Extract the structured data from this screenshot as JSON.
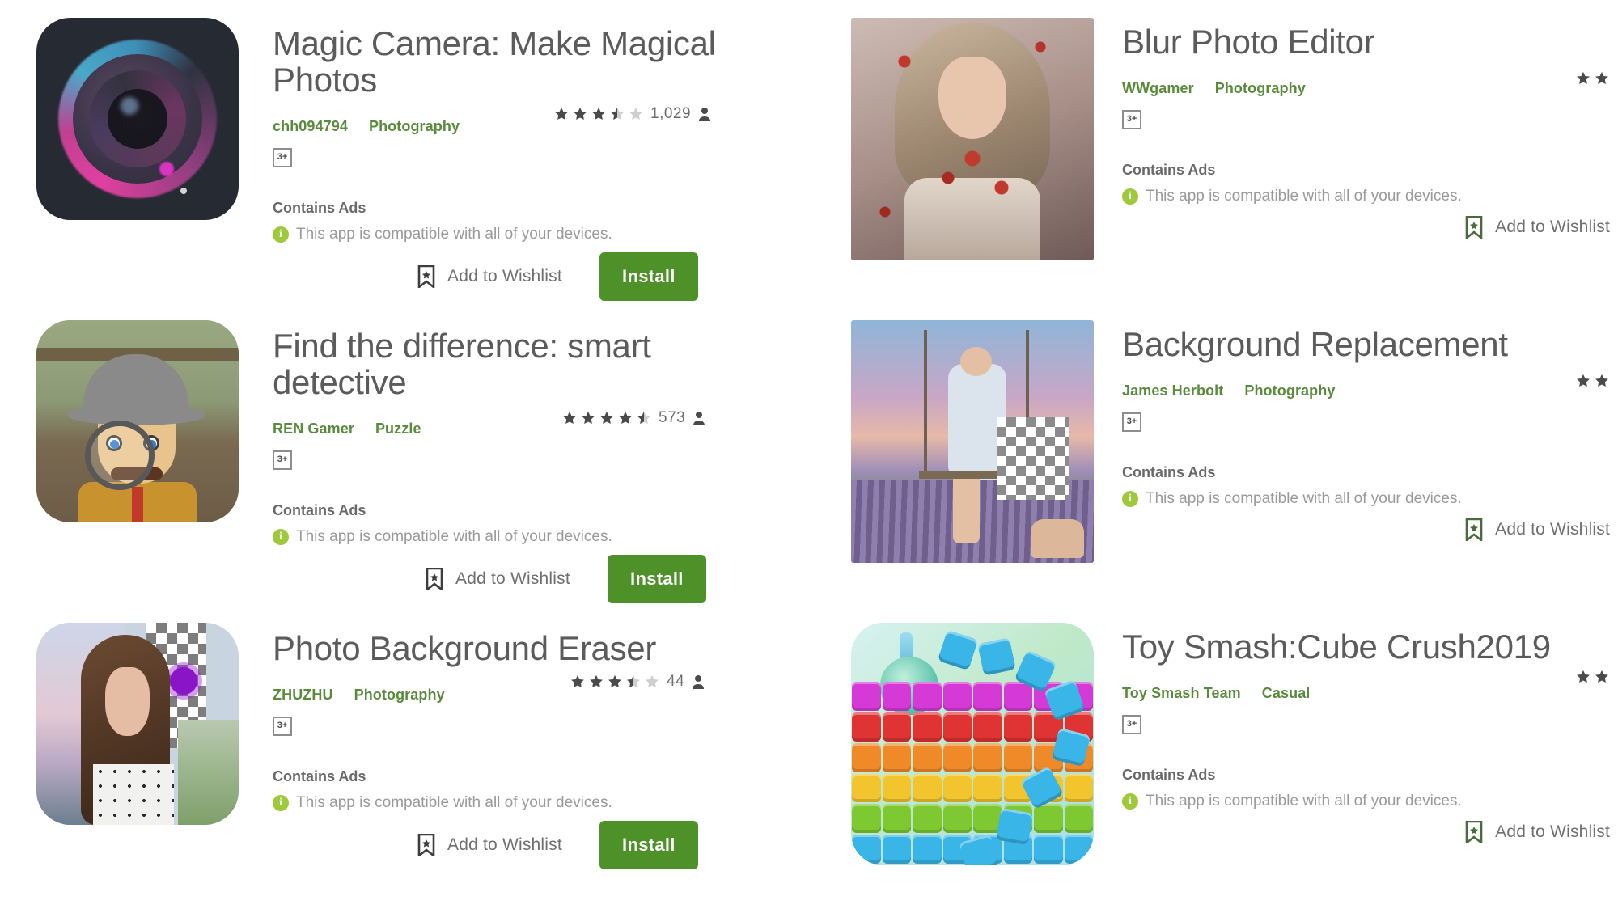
{
  "brand": {
    "install_green": "#4d9128",
    "link_green": "#5a8a3c",
    "info_green": "#9ec93a",
    "title_gray": "#5b5b5b",
    "muted_gray": "#9a9a9a"
  },
  "labels": {
    "contains_ads": "Contains Ads",
    "compatible": "This app is compatible with all of your devices.",
    "wishlist": "Add to Wishlist",
    "install": "Install",
    "age_rating": "3+"
  },
  "icons": {
    "star_full": "star-full-icon",
    "star_half": "star-half-icon",
    "star_empty": "star-empty-icon",
    "person": "person-icon",
    "bookmark": "bookmark-icon",
    "info": "info-icon",
    "age_badge": "age-rating-badge"
  },
  "left_column": [
    {
      "title": "Magic Camera: Make Magical Photos",
      "developer": "chh094794",
      "category": "Photography",
      "rating_full": 3,
      "rating_half": true,
      "rating_empty": 1,
      "rating_count": "1,029",
      "age_rating": "3+",
      "contains_ads": "Contains Ads",
      "compatible": "This app is compatible with all of your devices.",
      "wishlist": "Add to Wishlist",
      "install": "Install",
      "icon": "magic-camera-lens-icon"
    },
    {
      "title": "Find the difference: smart detective",
      "developer": "REN Gamer",
      "category": "Puzzle",
      "rating_full": 4,
      "rating_half": true,
      "rating_empty": 0,
      "rating_count": "573",
      "age_rating": "3+",
      "contains_ads": "Contains Ads",
      "compatible": "This app is compatible with all of your devices.",
      "wishlist": "Add to Wishlist",
      "install": "Install",
      "icon": "detective-character-icon"
    },
    {
      "title": "Photo Background Eraser",
      "developer": "ZHUZHU",
      "category": "Photography",
      "rating_full": 3,
      "rating_half": true,
      "rating_empty": 1,
      "rating_count": "44",
      "age_rating": "3+",
      "contains_ads": "Contains Ads",
      "compatible": "This app is compatible with all of your devices.",
      "wishlist": "Add to Wishlist",
      "install": "Install",
      "icon": "photo-eraser-portrait-icon"
    }
  ],
  "right_column": [
    {
      "title": "Blur Photo Editor",
      "developer": "WWgamer",
      "category": "Photography",
      "rating_visible_stars": 2,
      "age_rating": "3+",
      "contains_ads": "Contains Ads",
      "compatible": "This app is compatible with all of your devices.",
      "wishlist": "Add to Wishlist",
      "icon": "blur-photo-model-thumb"
    },
    {
      "title": "Background Replacement",
      "developer": "James Herbolt",
      "category": "Photography",
      "rating_visible_stars": 2,
      "age_rating": "3+",
      "contains_ads": "Contains Ads",
      "compatible": "This app is compatible with all of your devices.",
      "wishlist": "Add to Wishlist",
      "icon": "background-replacement-swing-thumb"
    },
    {
      "title": "Toy Smash:Cube Crush2019",
      "developer": "Toy Smash Team",
      "category": "Casual",
      "rating_visible_stars": 2,
      "age_rating": "3+",
      "contains_ads": "Contains Ads",
      "compatible": "This app is compatible with all of your devices.",
      "wishlist": "Add to Wishlist",
      "icon": "toy-smash-cubes-thumb"
    }
  ]
}
